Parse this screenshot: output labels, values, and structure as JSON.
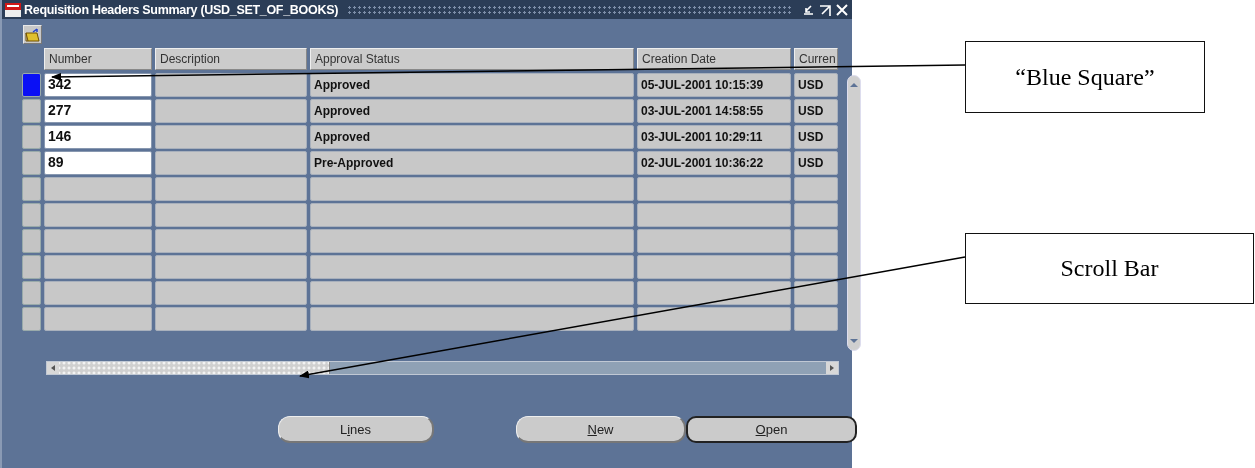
{
  "window": {
    "title": "Requisition Headers Summary (USD_SET_OF_BOOKS)"
  },
  "table": {
    "columns": [
      "Number",
      "Description",
      "Approval Status",
      "Creation Date",
      "Curren"
    ],
    "rows": [
      {
        "selected": true,
        "number": "342",
        "status": "Approved",
        "created": "05-JUL-2001 10:15:39",
        "currency": "USD"
      },
      {
        "selected": false,
        "number": "277",
        "status": "Approved",
        "created": "03-JUL-2001 14:58:55",
        "currency": "USD"
      },
      {
        "selected": false,
        "number": "146",
        "status": "Approved",
        "created": "03-JUL-2001 10:29:11",
        "currency": "USD"
      },
      {
        "selected": false,
        "number": "89",
        "status": "Pre-Approved",
        "created": "02-JUL-2001 10:36:22",
        "currency": "USD"
      },
      {
        "selected": false
      },
      {
        "selected": false
      },
      {
        "selected": false
      },
      {
        "selected": false
      },
      {
        "selected": false
      },
      {
        "selected": false
      }
    ]
  },
  "buttons": [
    {
      "before": "L",
      "key": "i",
      "after": "nes",
      "default": false
    },
    {
      "key": "N",
      "after": "ew",
      "default": false
    },
    {
      "key": "O",
      "after": "pen",
      "default": true
    }
  ],
  "callouts": [
    {
      "text": "“Blue Square”"
    },
    {
      "text": "Scroll Bar"
    }
  ]
}
